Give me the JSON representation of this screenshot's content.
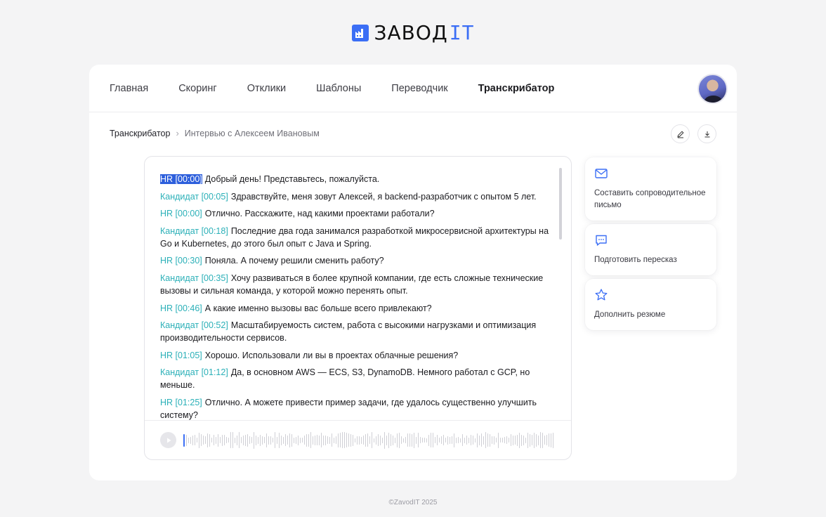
{
  "brand": {
    "name": "ЗАВОД",
    "suffix": "IT",
    "accent": "#3b6ef5"
  },
  "nav": {
    "items": [
      {
        "label": "Главная",
        "active": false
      },
      {
        "label": "Скоринг",
        "active": false
      },
      {
        "label": "Отклики",
        "active": false
      },
      {
        "label": "Шаблоны",
        "active": false
      },
      {
        "label": "Переводчик",
        "active": false
      },
      {
        "label": "Транскрибатор",
        "active": true
      }
    ]
  },
  "breadcrumb": {
    "root": "Транскрибатор",
    "separator": "›",
    "current": "Интервью с Алексеем Ивановым"
  },
  "toolbar": {
    "edit_icon": "pencil-icon",
    "download_icon": "download-icon"
  },
  "transcript": {
    "lines": [
      {
        "speaker": "HR [00:00]",
        "text": "Добрый день! Представьтесь, пожалуйста.",
        "selected": true
      },
      {
        "speaker": "Кандидат [00:05]",
        "text": "Здравствуйте, меня зовут Алексей, я backend-разработчик с опытом 5 лет.",
        "selected": false
      },
      {
        "speaker": "HR [00:00]",
        "text": "Отлично. Расскажите, над какими проектами работали?",
        "selected": false
      },
      {
        "speaker": "Кандидат [00:18]",
        "text": "Последние два года занимался разработкой микросервисной архитектуры на Go и Kubernetes, до этого был опыт с Java и Spring.",
        "selected": false
      },
      {
        "speaker": "HR [00:30]",
        "text": "Поняла. А почему решили сменить работу?",
        "selected": false
      },
      {
        "speaker": "Кандидат [00:35]",
        "text": "Хочу развиваться в более крупной компании, где есть сложные технические вызовы и сильная команда, у которой можно перенять опыт.",
        "selected": false
      },
      {
        "speaker": "HR [00:46]",
        "text": "А какие именно вызовы вас больше всего привлекают?",
        "selected": false
      },
      {
        "speaker": "Кандидат [00:52]",
        "text": "Масштабируемость систем, работа с высокими нагрузками и оптимизация производительности сервисов.",
        "selected": false
      },
      {
        "speaker": "HR [01:05]",
        "text": "Хорошо. Использовали ли вы в проектах облачные решения?",
        "selected": false
      },
      {
        "speaker": "Кандидат [01:12]",
        "text": "Да, в основном AWS — ECS, S3, DynamoDB. Немного работал с GCP, но меньше.",
        "selected": false
      },
      {
        "speaker": "HR [01:25]",
        "text": "Отлично. А можете привести пример задачи, где удалось существенно улучшить систему?",
        "selected": false
      }
    ],
    "speaker_color": "#2bb0b8",
    "selection_color": "#2d5fdc"
  },
  "player": {
    "play_icon": "play-icon",
    "progress": 0.0
  },
  "actions": [
    {
      "icon": "mail-icon",
      "label": "Составить сопроводительное письмо"
    },
    {
      "icon": "chat-icon",
      "label": "Подготовить пересказ"
    },
    {
      "icon": "star-icon",
      "label": "Дополнить резюме"
    }
  ],
  "footer": {
    "text": "©ZavodIT 2025"
  }
}
